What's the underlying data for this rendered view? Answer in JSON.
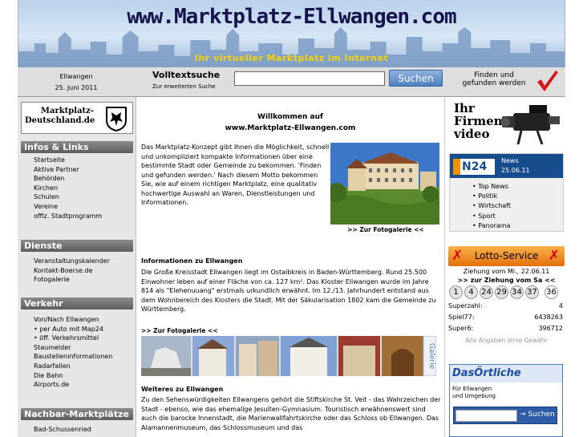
{
  "header": {
    "site_title": "www.Marktplatz-Ellwangen.com",
    "slogan": "Ihr virtueller Marktplatz im Internet"
  },
  "infobar": {
    "city": "Ellwangen",
    "date": "25. Juni 2011",
    "fulltext_title": "Volltextsuche",
    "fulltext_sub": "Zur erweiterten Suche",
    "search_value": "",
    "search_button": "Suchen",
    "found_line1": "Finden und",
    "found_line2": "gefunden werden"
  },
  "sidebar": {
    "logo_line1": "Marktplatz-",
    "logo_line2": "Deutschland.de",
    "sections": [
      {
        "title": "Infos & Links",
        "items": [
          "Startseite",
          "Aktive Partner",
          "Behörden",
          "Kirchen",
          "Schulen",
          "Vereine",
          "offiz. Stadtprogramm"
        ]
      },
      {
        "title": "Dienste",
        "items": [
          "Veranstaltungskalender",
          "Kontakt-Boerse.de",
          "Fotogalerie"
        ]
      },
      {
        "title": "Verkehr",
        "items": [
          "Von/Nach Ellwangen",
          "• per Auto mit Map24",
          "• öff. Verkehrsmittel",
          "Staumelder",
          "Baustelleninformationen",
          "Radarfallen",
          "Die Bahn",
          "Airports.de"
        ]
      },
      {
        "title": "Nachbar-Marktplätze",
        "items": [
          "Bad-Schussenried"
        ]
      }
    ]
  },
  "main": {
    "welcome_line1": "Willkommen auf",
    "welcome_line2": "www.Marktplatz-Ellwangen.com",
    "intro": "Das Marktplatz-Konzept gibt Ihnen die Möglichkeit, schnell und unkompliziert kompakte Informationen über eine bestimmte Stadt oder Gemeinde zu bekommen. 'Finden und gefunden werden.' Nach diesem Motto bekommen Sie, wie auf einem richtigen Marktplatz, eine qualitativ hochwertige Auswahl an Waren, Dienstleistungen und Informationen.",
    "gallery_link": ">> Zur Fotogalerie <<",
    "info_heading": "Informationen zu Ellwangen",
    "info_text": "Die Große Kreisstadt Ellwangen liegt im Ostalbkreis in Baden-Württemberg. Rund 25.500 Einwohner leben auf einer Fläche von ca. 127 km². Das Kloster Ellwangen wurde im Jahre 814 als \"Elehenuuang\" erstmals urkundlich erwähnt. Im 12./13. Jahrhundert entstand aus dem Wohnbereich des Klosters die Stadt. Mit der Säkularisation 1802 kam die Gemeinde zu Württemberg.",
    "gallery_link2": ">> Zur Fotogalerie <<",
    "gallery_label": "Galerie",
    "further_heading": "Weiteres zu Ellwangen",
    "further_text": "Zu den Sehenswürdigkeiten Ellwangens gehört die Stiftskirche St. Veit - das Wahrzeichen der Stadt - ebenso, wie das ehemalige Jesuiten-Gymnasium. Touristisch erwähnenswert sind auch die barocke Innenstadt, die Marienwallfahrtskirche oder das Schloss ob Ellwangen. Das Alamannenmuseum, das Schlossmuseum und das"
  },
  "right": {
    "video_ad": [
      "Ihr",
      "Firmen-",
      "video"
    ],
    "n24": {
      "logo": "N24",
      "label": "News",
      "date": "25.06.11",
      "items": [
        "• Top News",
        "• Politik",
        "• Wirtschaft",
        "• Sport",
        "• Panorama"
      ]
    },
    "lotto": {
      "title": "Lotto-Service",
      "draw_line": "Ziehung vom Mi., 22.06.11",
      "next_link": ">> zur Ziehung vom Sa <<",
      "numbers": [
        "1",
        "4",
        "24",
        "29",
        "34",
        "37",
        "36"
      ],
      "rows": [
        {
          "label": "Superzahl:",
          "value": "4"
        },
        {
          "label": "Spiel77:",
          "value": "6438263"
        },
        {
          "label": "Super6:",
          "value": "396712"
        }
      ],
      "footer": "Alle Angaben ohne Gewähr"
    },
    "dasoertliche": {
      "logo": "DasÖrtliche",
      "sub1": "Für Ellwangen",
      "sub2": "und Umgebung",
      "button": "→ Suchen"
    }
  },
  "colors": {
    "banner_sky": "#c8dbef",
    "title": "#14144a",
    "slogan": "#f5d200",
    "section_head": "#6e6e6e",
    "search_button": "#5b88c8",
    "n24_blue": "#174d8c",
    "lotto_orange": "#f0901e",
    "check_red": "#d81818"
  }
}
